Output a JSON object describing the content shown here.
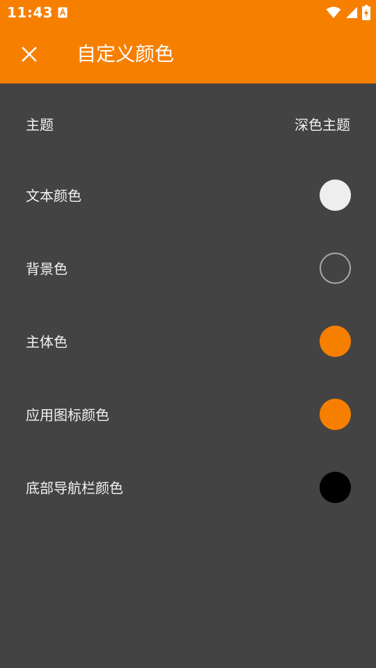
{
  "status_bar": {
    "time": "11:43",
    "notification_icon": "accessibility-a-icon",
    "icons": [
      "wifi-icon",
      "signal-icon",
      "battery-charging-icon"
    ]
  },
  "app_bar": {
    "title": "自定义颜色",
    "close_icon": "close-icon",
    "background_color": "#F77F00"
  },
  "settings": {
    "theme": {
      "label": "主题",
      "value": "深色主题"
    },
    "text_color": {
      "label": "文本颜色",
      "color": "#EEEEEE"
    },
    "background_color": {
      "label": "背景色",
      "color": "#434343"
    },
    "primary_color": {
      "label": "主体色",
      "color": "#F77F00"
    },
    "app_icon_color": {
      "label": "应用图标颜色",
      "color": "#F77F00"
    },
    "nav_bar_color": {
      "label": "底部导航栏颜色",
      "color": "#000000"
    }
  },
  "colors": {
    "screen_background": "#434343",
    "text": "#F2F2F2",
    "swatch_outline": "#A8A8A8"
  }
}
